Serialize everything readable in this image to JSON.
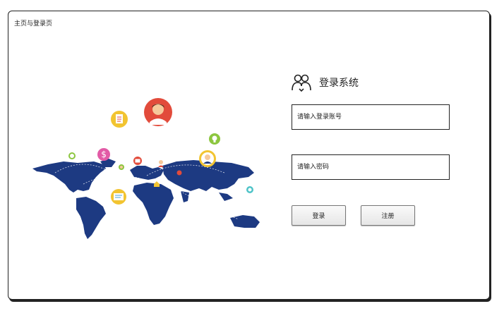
{
  "window": {
    "title": "主页与登录页"
  },
  "login": {
    "title": "登录系统",
    "account_placeholder": "请输入登录账号",
    "password_placeholder": "请输入密码",
    "login_label": "登录",
    "register_label": "注册"
  },
  "colors": {
    "map": "#1d3a82",
    "avatar_red": "#e24b3b",
    "note_yellow": "#f2c431",
    "dollar_pink": "#e25aa6",
    "bulb_green": "#8cc63f"
  },
  "illustration": {
    "icons": [
      "user-avatar-icon",
      "document-icon",
      "dollar-icon",
      "lightbulb-icon",
      "user-avatar-icon",
      "message-icon",
      "mail-icon",
      "location-pin-icon"
    ]
  }
}
